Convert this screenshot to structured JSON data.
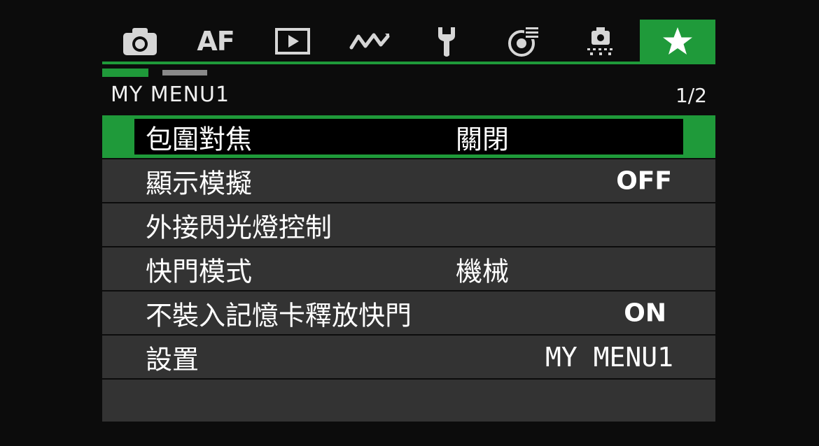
{
  "tabs": [
    {
      "icon": "camera-icon"
    },
    {
      "label": "AF",
      "icon": "af-icon"
    },
    {
      "icon": "playback-icon"
    },
    {
      "icon": "network-icon"
    },
    {
      "icon": "wrench-icon"
    },
    {
      "icon": "custom-settings-icon"
    },
    {
      "icon": "camera-body-icon"
    },
    {
      "icon": "star-icon",
      "active": true
    }
  ],
  "accent_color": "#1f9a3a",
  "menu": {
    "title": "MY MENU1",
    "page": "1/2",
    "items": [
      {
        "label": "包圍對焦",
        "value": "關閉"
      },
      {
        "label": "顯示模擬",
        "value": "OFF"
      },
      {
        "label": "外接閃光燈控制",
        "value": ""
      },
      {
        "label": "快門模式",
        "value": "機械"
      },
      {
        "label": "不裝入記憶卡釋放快門",
        "value": "ON"
      },
      {
        "label": "設置",
        "value": "MY MENU1"
      }
    ]
  }
}
